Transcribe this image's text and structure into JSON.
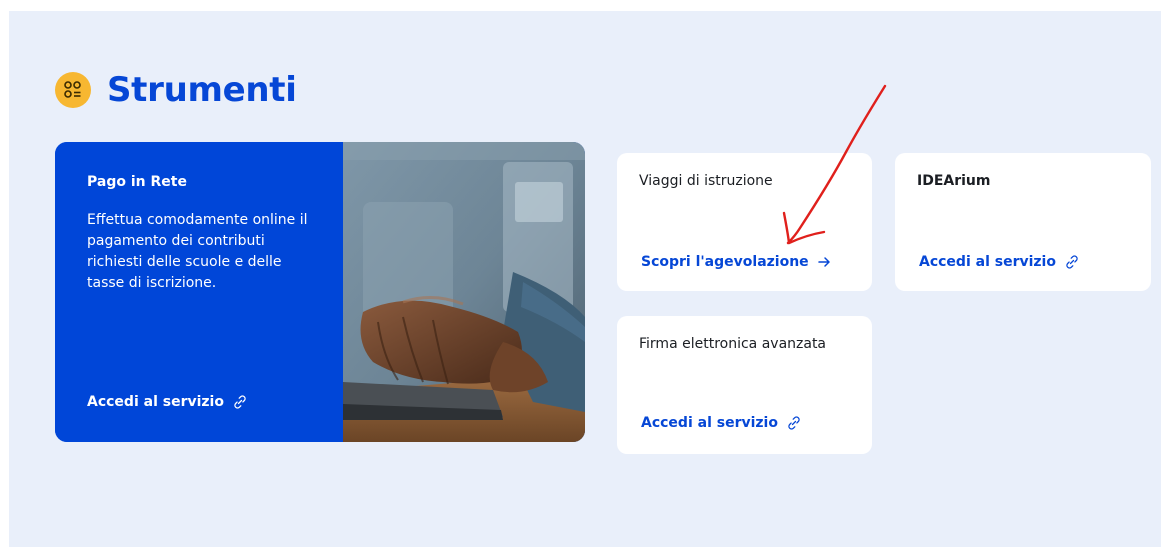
{
  "section": {
    "title": "Strumenti",
    "icon": "grid-apps-icon"
  },
  "cards": {
    "pago": {
      "title": "Pago in Rete",
      "description": "Effettua comodamente online il pagamento dei contributi richiesti delle scuole e delle tasse di iscrizione.",
      "link": "Accedi al servizio",
      "image": "laptop-typing-photo"
    },
    "viaggi": {
      "title": "Viaggi di istruzione",
      "link": "Scopri l'agevolazione"
    },
    "idearium": {
      "title": "IDEArium",
      "link": "Accedi al servizio"
    },
    "firma": {
      "title": "Firma elettronica avanzata",
      "link": "Accedi al servizio"
    }
  },
  "colors": {
    "accent": "#0647d6",
    "feature_bg": "#0046d8",
    "section_bg": "#e9effa",
    "icon_bg": "#f7b731",
    "annotation": "#e0201c"
  }
}
